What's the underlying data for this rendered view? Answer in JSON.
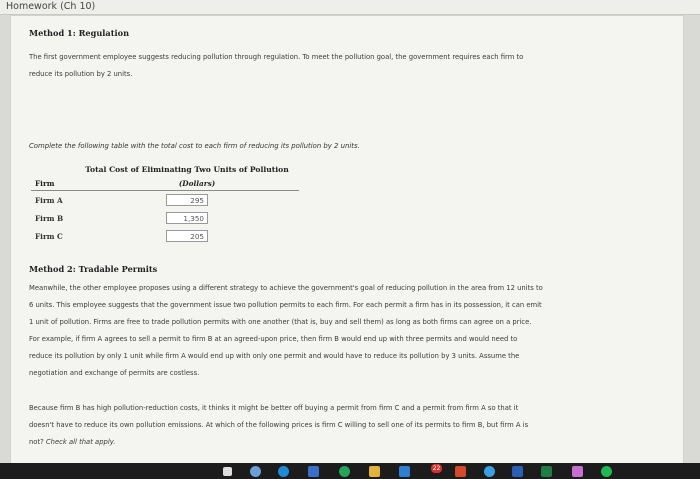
{
  "window": {
    "title": "Homework (Ch 10)"
  },
  "method1": {
    "heading": "Method 1: Regulation",
    "para_line1": "The first government employee suggests reducing pollution through regulation. To meet the pollution goal, the government requires each firm to",
    "para_line2": "reduce its pollution by 2 units."
  },
  "instruction": "Complete the following table with the total cost to each firm of reducing its pollution by 2 units.",
  "table": {
    "title": "Total Cost of Eliminating Two Units of Pollution",
    "col_firm": "Firm",
    "col_cost": "(Dollars)",
    "rows": [
      {
        "firm": "Firm A",
        "value": "295"
      },
      {
        "firm": "Firm B",
        "value": "1,350"
      },
      {
        "firm": "Firm C",
        "value": "205"
      }
    ]
  },
  "method2": {
    "heading": "Method 2: Tradable Permits",
    "lines": [
      "Meanwhile, the other employee proposes using a different strategy to achieve the government's goal of reducing pollution in the area from 12 units to",
      "6 units. This employee suggests that the government issue two pollution permits to each firm. For each permit a firm has in its possession, it can emit",
      "1 unit of pollution. Firms are free to trade pollution permits with one another (that is, buy and sell them) as long as both firms can agree on a price.",
      "For example, if firm A agrees to sell a permit to firm B at an agreed-upon price, then firm B would end up with three permits and would need to",
      "reduce its pollution by only 1 unit while firm A would end up with only one permit and would have to reduce its pollution by 3 units. Assume the",
      "negotiation and exchange of permits are costless."
    ]
  },
  "question": {
    "line1": "Because firm B has high pollution-reduction costs, it thinks it might be better off buying a permit from firm C and a permit from firm A so that it",
    "line2": "doesn't have to reduce its own pollution emissions. At which of the following prices is firm C willing to sell one of its permits to firm B, but firm A is",
    "line3_text": "not? ",
    "line3_instr": "Check all that apply."
  },
  "taskbar": {
    "badge": "22",
    "icons": [
      "windows-start-icon",
      "search-icon",
      "edge-browser-icon",
      "store-icon",
      "chrome-icon",
      "file-explorer-icon",
      "mail-icon",
      "office-icon",
      "media-icon",
      "word-icon",
      "excel-icon",
      "photos-icon",
      "spotify-icon"
    ]
  }
}
